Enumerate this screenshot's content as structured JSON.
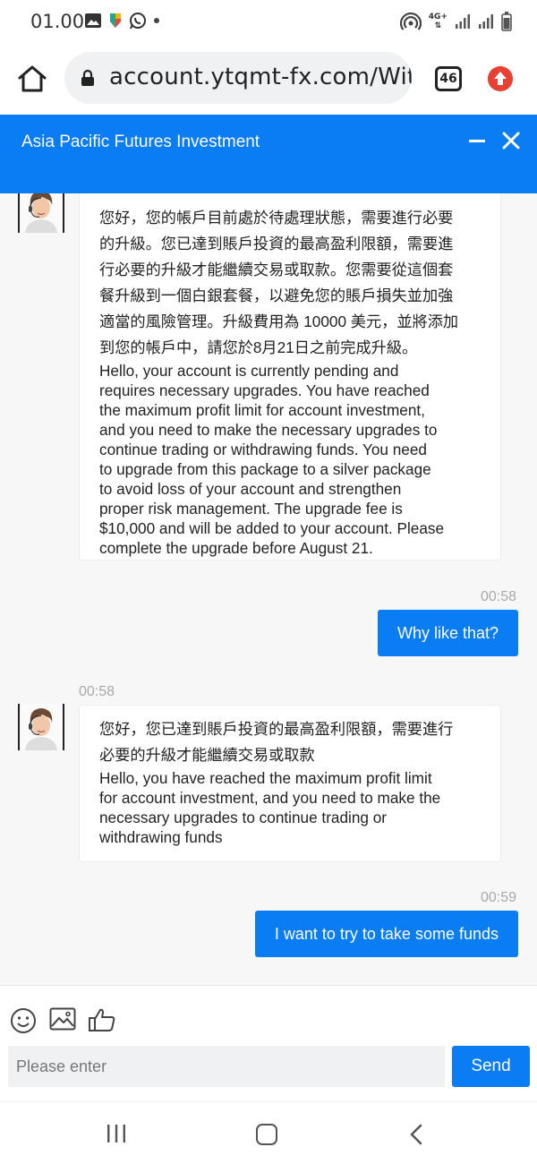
{
  "status_bar": {
    "time": "01.00",
    "left_icons": [
      "image-icon",
      "app-icon",
      "whatsapp-icon",
      "dot-icon"
    ],
    "right_icons": [
      "hotspot-icon",
      "4g-icon",
      "signal-icon",
      "signal-icon",
      "battery-icon"
    ],
    "network_label": "4G+"
  },
  "browser": {
    "url": "account.ytqmt-fx.com/Withd",
    "tab_count": "46"
  },
  "chat_header": {
    "title": "Asia Pacific Futures Investment"
  },
  "messages": [
    {
      "direction": "incoming",
      "text_zh": "您好，您的帳戶目前處於待處理狀態，需要進行必要\n的升級。您已達到賬戶投資的最高盈利限額，需要進\n行必要的升級才能繼續交易或取款。您需要從這個套\n餐升級到一個白銀套餐，以避免您的賬戶損失並加強\n適當的風險管理。升級費用為 10000 美元，並將添加\n到您的帳戶中，請您於8月21日之前完成升級。",
      "text_en": "Hello, your account is currently pending and\nrequires necessary upgrades. You have reached\nthe maximum profit limit for account investment,\nand you need to make the necessary upgrades to\ncontinue trading or withdrawing funds. You need\nto upgrade from this package to a silver package\nto avoid loss of your account and strengthen\nproper risk management. The upgrade fee is\n$10,000 and will be added to your account. Please\ncomplete the upgrade before August 21."
    },
    {
      "direction": "outgoing",
      "time": "00:58",
      "text": "Why like that?"
    },
    {
      "direction": "incoming",
      "time": "00:58",
      "text_zh": "您好，您已達到賬戶投資的最高盈利限額，需要進行\n必要的升級才能繼續交易或取款",
      "text_en": "Hello, you have reached the maximum profit limit\nfor account investment, and you need to make the\nnecessary upgrades to continue trading or\nwithdrawing funds"
    },
    {
      "direction": "outgoing",
      "time": "00:59",
      "text": "I want to try to take some funds"
    }
  ],
  "input_area": {
    "tools": [
      "emoji-icon",
      "image-icon",
      "thumbs-up-icon"
    ],
    "placeholder": "Please enter",
    "send_label": "Send"
  },
  "colors": {
    "accent": "#0a7cf4",
    "chat_background": "#f7f7f7",
    "timestamp": "#a8a8a8",
    "upgrade_badge": "#e84033"
  }
}
